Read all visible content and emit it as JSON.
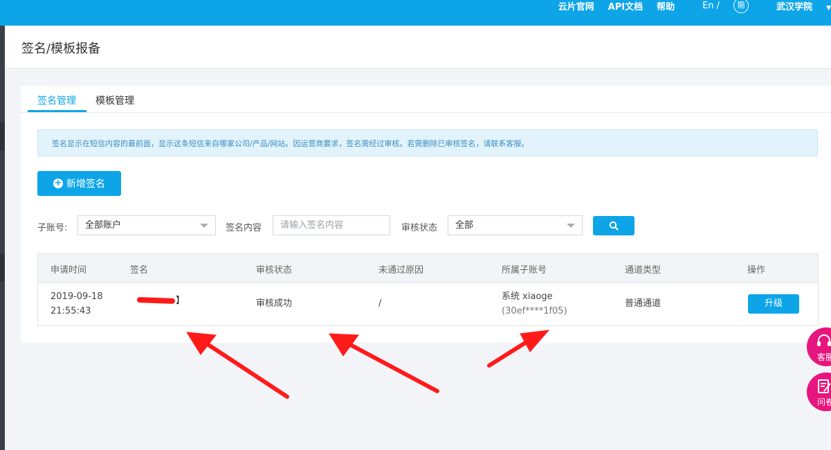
{
  "topbar": {
    "links": [
      "云片官网",
      "API文档",
      "帮助"
    ],
    "lang_en": "En /",
    "lang_cn": "簡",
    "academy": "武汉学院"
  },
  "page": {
    "title": "签名/模板报备"
  },
  "tabs": [
    {
      "label": "签名管理",
      "active": true
    },
    {
      "label": "模板管理",
      "active": false
    }
  ],
  "notice": "签名显示在短信内容的最前面，显示这条短信来自哪家公司/产品/网站。因运营商要求，签名需经过审核。若需删除已审核签名，请联系客服。",
  "add_button": "新增签名",
  "filters": {
    "sub_account_label": "子账号:",
    "sub_account_value": "全部账户",
    "sign_content_label": "签名内容",
    "sign_content_placeholder": "请输入签名内容",
    "audit_status_label": "审核状态",
    "audit_status_value": "全部"
  },
  "table": {
    "headers": [
      "申请时间",
      "签名",
      "审核状态",
      "未通过原因",
      "所属子账号",
      "通道类型",
      "操作"
    ],
    "rows": [
      {
        "date": "2019-09-18",
        "time": "21:55:43",
        "signature_bracket": "】",
        "status": "审核成功",
        "reason": "/",
        "account_name": "系统 xiaoge",
        "account_id": "(30ef****1f05)",
        "channel": "普通通道",
        "action": "升级"
      }
    ]
  },
  "float_buttons": [
    {
      "label": "客服",
      "icon": "headset-icon"
    },
    {
      "label": "问卷",
      "icon": "survey-icon"
    }
  ],
  "colors": {
    "primary": "#0ea5e8",
    "annotation_red": "#ff1a1a",
    "float_pink": "#e6167e"
  }
}
